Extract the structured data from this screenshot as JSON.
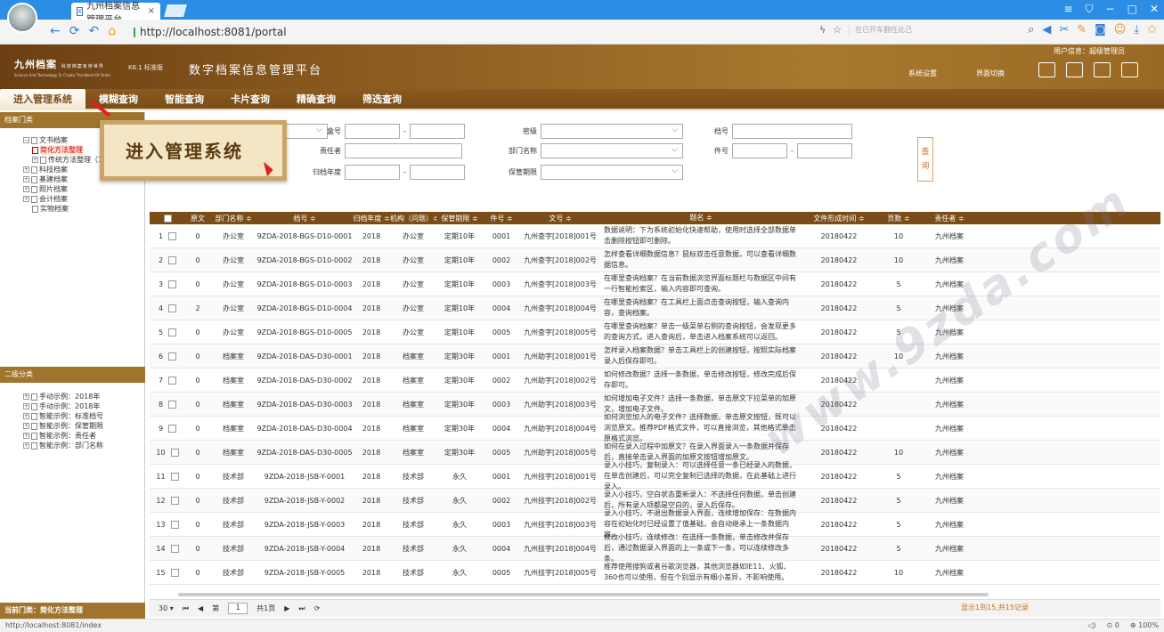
{
  "browser": {
    "tab_title": "九州档案信息管理平台",
    "tab_close": "×",
    "url": "http://localhost:8081/portal",
    "search_placeholder": "在已开车翻任此己",
    "zoom": "100%",
    "status_url": "http://localhost:8081/index",
    "status_count": "0"
  },
  "app": {
    "logo_name": "九州档案",
    "logo_sub": "科技档案有序世界",
    "logo_tagline": "Science And Technology To Create The World Of Order",
    "version": "K6.1 标准版",
    "title": "数字档案信息管理平台",
    "user_info": "用户信息：超级管理员",
    "link_settings": "系统设置",
    "link_switch": "界面切换"
  },
  "nav": {
    "items": [
      "进入管理系统",
      "模糊查询",
      "智能查询",
      "卡片查询",
      "精确查询",
      "筛选查询"
    ],
    "active_index": 0
  },
  "callout": {
    "text": "进入管理系统"
  },
  "left": {
    "header1": "档案门类",
    "tree1": [
      {
        "label": "文书档案",
        "level": 0
      },
      {
        "label": "简化方法整理",
        "level": 1,
        "selected": true
      },
      {
        "label": "传统方法整理（1",
        "level": 1
      },
      {
        "label": "科技档案",
        "level": 0
      },
      {
        "label": "基建档案",
        "level": 0
      },
      {
        "label": "照片档案",
        "level": 0
      },
      {
        "label": "会计档案",
        "level": 0
      },
      {
        "label": "实物档案",
        "level": 0
      }
    ],
    "header2": "二级分类",
    "tree2": [
      "手动示例：2018年",
      "手动示例：2018年",
      "智能示例：标准档号",
      "智能示例：保管期限",
      "智能示例：责任者",
      "智能示例：部门名称"
    ],
    "current_class": "当前门类：简化方法整理"
  },
  "search": {
    "box_no": "盒号",
    "responsible": "责任者",
    "year": "归档年度",
    "secret": "密级",
    "dept": "部门名称",
    "retention": "保管期限",
    "archive_no": "档号",
    "item_no": "件号",
    "dash": "-",
    "query_button": [
      "查",
      "询"
    ]
  },
  "table": {
    "headers": [
      "原文",
      "部门名称 ≑",
      "档号 ≑",
      "归档年度 ≑",
      "机构（问题）≑",
      "保管期限 ≑",
      "件号 ≑",
      "文号 ≑",
      "题名 ≑",
      "文件形成时间 ≑",
      "页数 ≑",
      "责任者 ≑"
    ],
    "rows": [
      [
        "1",
        "0",
        "办公室",
        "9ZDA-2018-BGS-D10-0001",
        "2018",
        "办公室",
        "定期10年",
        "0001",
        "九州查字[2018]001号",
        "数据说明：下为系统初始化快速帮助，使用时选择全部数据单击删除按钮即可删除。",
        "20180422",
        "10",
        "九州档案"
      ],
      [
        "2",
        "0",
        "办公室",
        "9ZDA-2018-BGS-D10-0002",
        "2018",
        "办公室",
        "定期10年",
        "0002",
        "九州查字[2018]002号",
        "怎样查看详细数据信息？鼠标双击任意数据，可以查看详细数据信息。",
        "20180422",
        "10",
        "九州档案"
      ],
      [
        "3",
        "0",
        "办公室",
        "9ZDA-2018-BGS-D10-0003",
        "2018",
        "办公室",
        "定期10年",
        "0003",
        "九州查字[2018]003号",
        "在哪里查询档案？在当前数据浏览界面标题栏与数据区中间有一行智能检索区，输入内容即可查询。",
        "20180422",
        "5",
        "九州档案"
      ],
      [
        "4",
        "2",
        "办公室",
        "9ZDA-2018-BGS-D10-0004",
        "2018",
        "办公室",
        "定期10年",
        "0004",
        "九州查字[2018]004号",
        "在哪里查询档案？在工具栏上面点击查询按钮，输入查询内容，查询档案。",
        "20180422",
        "5",
        "九州档案"
      ],
      [
        "5",
        "0",
        "办公室",
        "9ZDA-2018-BGS-D10-0005",
        "2018",
        "办公室",
        "定期10年",
        "0005",
        "九州查字[2018]005号",
        "在哪里查询档案？单击一级菜单右侧的查询按钮，会发现更多的查询方式，进入查询后，单击进入档案系统可以返回。",
        "20180422",
        "5",
        "九州档案"
      ],
      [
        "6",
        "0",
        "档案室",
        "9ZDA-2018-DAS-D30-0001",
        "2018",
        "档案室",
        "定期30年",
        "0001",
        "九州助字[2018]001号",
        "怎样录入档案数据？单击工具栏上的创建按钮，按照实际档案录入后保存即可。",
        "20180422",
        "10",
        "九州档案"
      ],
      [
        "7",
        "0",
        "档案室",
        "9ZDA-2018-DAS-D30-0002",
        "2018",
        "档案室",
        "定期30年",
        "0002",
        "九州助字[2018]002号",
        "如何修改数据？选择一条数据，单击修改按钮，修改完成后保存即可。",
        "20180422",
        "",
        "九州档案"
      ],
      [
        "8",
        "0",
        "档案室",
        "9ZDA-2018-DAS-D30-0003",
        "2018",
        "档案室",
        "定期30年",
        "0003",
        "九州助字[2018]003号",
        "如何增加电子文件？选择一条数据，单击原文下拉菜单的加原文，增加电子文件。",
        "20180422",
        "",
        "九州档案"
      ],
      [
        "9",
        "0",
        "档案室",
        "9ZDA-2018-DAS-D30-0004",
        "2018",
        "档案室",
        "定期30年",
        "0004",
        "九州助字[2018]004号",
        "如何浏览加入的电子文件？选择数据，单击原文按钮，既可以浏览原文。推荐PDF格式文件，可以直接浏览，其他格式单击原格式浏览。",
        "20180422",
        "",
        "九州档案"
      ],
      [
        "10",
        "0",
        "档案室",
        "9ZDA-2018-DAS-D30-0005",
        "2018",
        "档案室",
        "定期30年",
        "0005",
        "九州助字[2018]005号",
        "如何在录入过程中加原文？在录入界面录入一条数据并保存后，直接单击录入界面的加原文按钮增加原文。",
        "20180422",
        "10",
        "九州档案"
      ],
      [
        "11",
        "0",
        "技术部",
        "9ZDA-2018-JSB-Y-0001",
        "2018",
        "技术部",
        "永久",
        "0001",
        "九州技字[2018]001号",
        "录入小技巧，复制录入：可以选择任意一条已经录入的数据，在单击创建后，可以完全复制已选择的数据，在此基础上进行录入。",
        "20180422",
        "5",
        "九州档案"
      ],
      [
        "12",
        "0",
        "技术部",
        "9ZDA-2018-JSB-Y-0002",
        "2018",
        "技术部",
        "永久",
        "0002",
        "九州技字[2018]002号",
        "录入小技巧，空白状态重新录入：不选择任何数据，单击创建后，所有录入项都是空白的，录入后保存。",
        "20180422",
        "5",
        "九州档案"
      ],
      [
        "13",
        "0",
        "技术部",
        "9ZDA-2018-JSB-Y-0003",
        "2018",
        "技术部",
        "永久",
        "0003",
        "九州技字[2018]003号",
        "录入小技巧，不退出数据录入界面，连续增加保存：在数据内容在初始化时已经设置了值基础，会自动继承上一条数据内容。",
        "20180422",
        "5",
        "九州档案"
      ],
      [
        "14",
        "0",
        "技术部",
        "9ZDA-2018-JSB-Y-0004",
        "2018",
        "技术部",
        "永久",
        "0004",
        "九州技字[2018]004号",
        "修改小技巧，连续修改：在选择一条数据，单击修改并保存后，通过数据录入界面的上一条或下一条，可以连续修改多条。",
        "20180422",
        "5",
        "九州档案"
      ],
      [
        "15",
        "0",
        "技术部",
        "9ZDA-2018-JSB-Y-0005",
        "2018",
        "技术部",
        "永久",
        "0005",
        "九州技字[2018]005号",
        "推荐使用搜狗或者谷歌浏览器，其他浏览器如IE11、火狐、360也可以使用，但在个别显示有细小差异，不影响使用。",
        "20180422",
        "10",
        "九州档案"
      ]
    ]
  },
  "pager": {
    "page_size": "30",
    "page_label_pre": "第",
    "page_value": "1",
    "page_label_post": "共1页",
    "info": "显示1到15,共15记录"
  },
  "watermark": "www.9zda.com",
  "colors": {
    "brand": "#8a5a1f",
    "header": "#7a4c17",
    "accent": "#c07020"
  }
}
